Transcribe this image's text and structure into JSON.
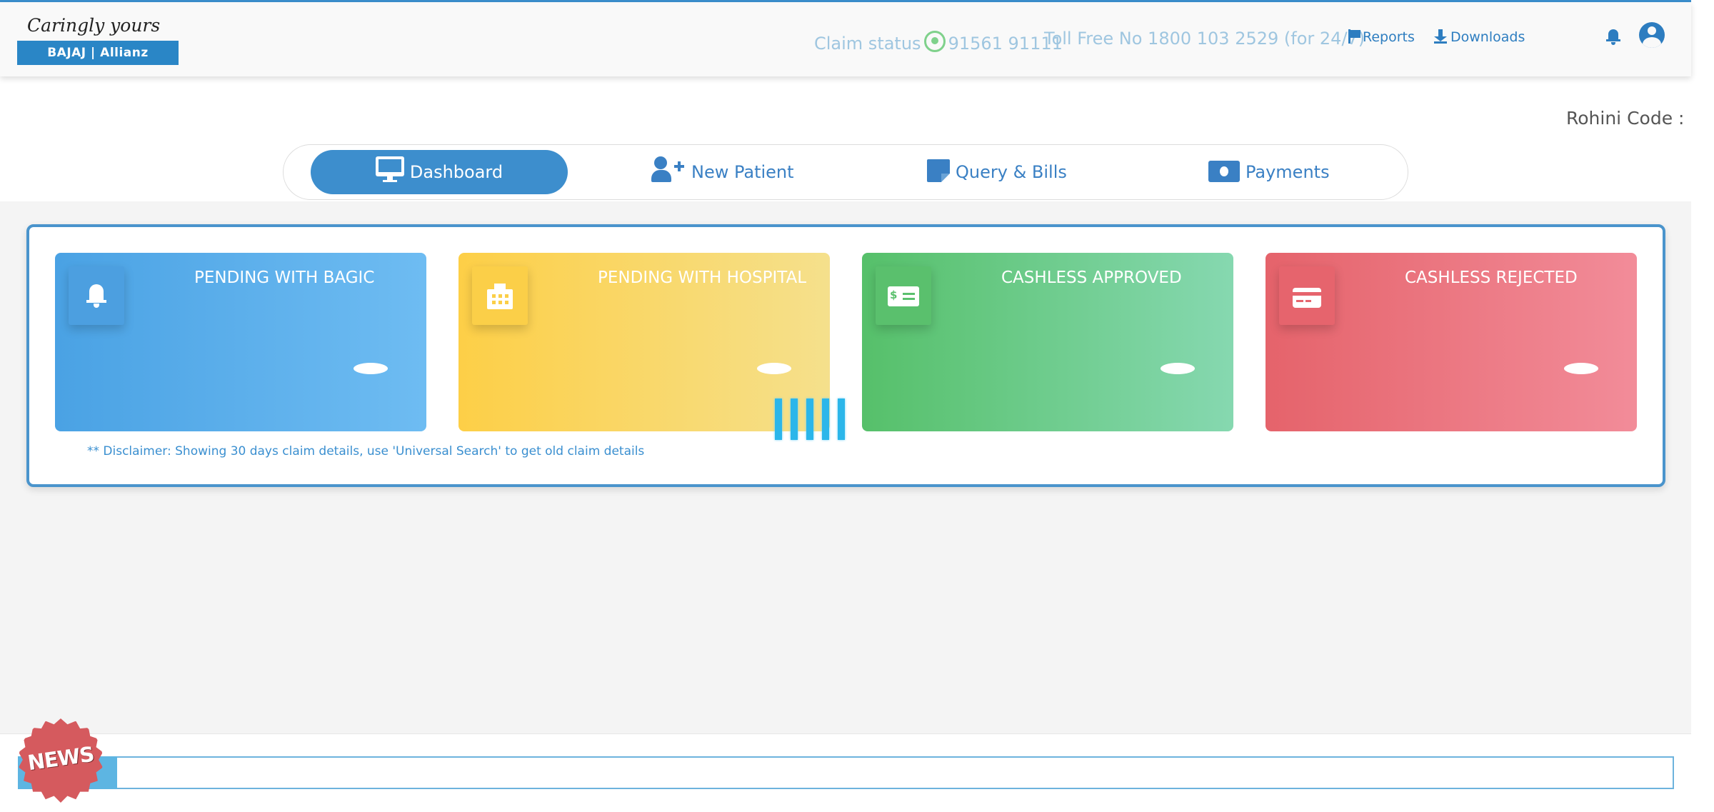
{
  "header": {
    "logo": {
      "tagline": "Caringly yours",
      "brand": "BAJAJ | Allianz"
    },
    "claim_status_label": "Claim status",
    "claim_status_phone": "91561 91111",
    "toll_free": "Toll Free No 1800 103 2529 (for 24/7)",
    "reports_label": "Reports",
    "downloads_label": "Downloads",
    "icons": [
      "whatsapp-icon",
      "flag-icon",
      "download-icon",
      "bell-icon",
      "user-icon"
    ]
  },
  "rohini_label": "Rohini Code :",
  "tabs": [
    {
      "label": "Dashboard",
      "icon": "monitor-icon",
      "active": true
    },
    {
      "label": "New Patient",
      "icon": "user-plus-icon",
      "active": false
    },
    {
      "label": "Query & Bills",
      "icon": "note-icon",
      "active": false
    },
    {
      "label": "Payments",
      "icon": "money-icon",
      "active": false
    }
  ],
  "cards": [
    {
      "title": "PENDING WITH BAGIC",
      "icon": "bell-icon",
      "color": "#4aa2e4"
    },
    {
      "title": "PENDING WITH HOSPITAL",
      "icon": "hospital-icon",
      "color": "#fdcf47"
    },
    {
      "title": "CASHLESS APPROVED",
      "icon": "money-bill-icon",
      "color": "#56c06a"
    },
    {
      "title": "CASHLESS REJECTED",
      "icon": "credit-card-icon",
      "color": "#e5636b"
    }
  ],
  "disclaimer": "** Disclaimer: Showing 30 days claim details, use 'Universal Search' to get old claim details",
  "news": {
    "badge": "NEWS"
  },
  "colors": {
    "primary": "#3d8ecd",
    "link": "#2d7dc0",
    "header_text": "#9fc6e0"
  }
}
